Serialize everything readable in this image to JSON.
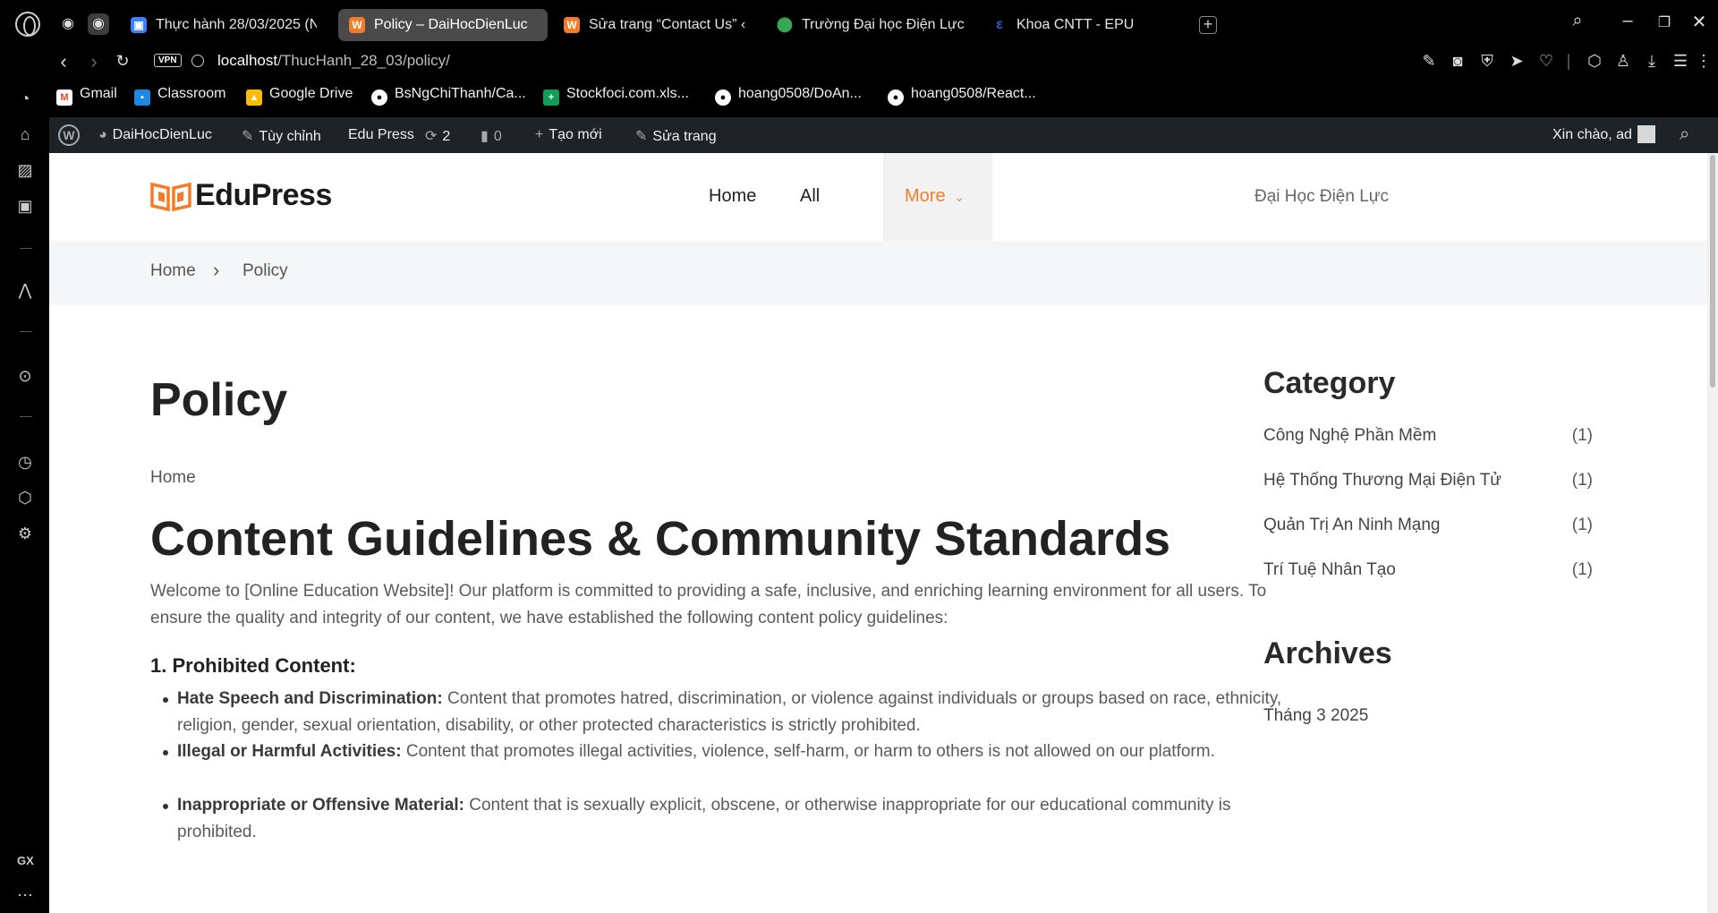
{
  "browser": {
    "tabs": [
      {
        "title": "Thực hành 28/03/2025 (N",
        "icon": "contact-card-icon",
        "color": "#3b82f6"
      },
      {
        "title": "Policy – DaiHocDienLuc",
        "icon": "edupress-favicon",
        "color": "#f57c26",
        "active": true
      },
      {
        "title": "Sửa trang “Contact Us” ‹ D",
        "icon": "edupress-favicon",
        "color": "#f57c26"
      },
      {
        "title": "Trường Đại học Điện Lực -",
        "icon": "map-pin-icon",
        "color": "#34a853"
      },
      {
        "title": "Khoa CNTT - EPU",
        "icon": "epu-logo-icon",
        "color": "#2b5bd7"
      }
    ],
    "url_host": "localhost",
    "url_path": "/ThucHanh_28_03/policy/",
    "vpn_label": "VPN",
    "bookmarks": [
      {
        "label": "Gmail",
        "icon": "gmail-icon"
      },
      {
        "label": "Classroom",
        "icon": "classroom-icon"
      },
      {
        "label": "Google Drive",
        "icon": "drive-icon"
      },
      {
        "label": "BsNgChiThanh/Ca...",
        "icon": "github-icon"
      },
      {
        "label": "Stockfoci.com.xls...",
        "icon": "sheets-icon"
      },
      {
        "label": "hoang0508/DoAn...",
        "icon": "github-icon"
      },
      {
        "label": "hoang0508/React...",
        "icon": "github-icon"
      }
    ],
    "sidebar_gx": "GX"
  },
  "wpbar": {
    "site_name": "DaiHocDienLuc",
    "customize": "Tùy chỉnh",
    "theme": "Edu Press",
    "updates": "2",
    "comments": "0",
    "new": "Tạo mới",
    "edit": "Sửa trang",
    "greeting": "Xin chào, ad"
  },
  "site": {
    "logo_text": "EduPress",
    "nav": {
      "home": "Home",
      "all_post": "All Post",
      "more": "More"
    },
    "header_right": "Đại Học Điện Lực",
    "breadcrumb": {
      "home": "Home",
      "current": "Policy"
    },
    "accent": "#f57c26"
  },
  "main": {
    "page_title": "Policy",
    "home_link": "Home",
    "heading": "Content Guidelines & Community Standards",
    "intro": "Welcome to [Online Education Website]! Our platform is committed to providing a safe, inclusive, and enriching learning environment for all users. To ensure the quality and integrity of our content, we have established the following content policy guidelines:",
    "section1": "1. Prohibited Content:",
    "items": [
      {
        "bold": "Hate Speech and Discrimination:",
        "text": " Content that promotes hatred, discrimination, or violence against individuals or groups based on race, ethnicity, religion, gender, sexual orientation, disability, or other protected characteristics is strictly prohibited."
      },
      {
        "bold": "Illegal or Harmful Activities:",
        "text": " Content that promotes illegal activities, violence, self-harm, or harm to others is not allowed on our platform."
      },
      {
        "bold": "Inappropriate or Offensive Material:",
        "text": " Content that is sexually explicit, obscene, or otherwise inappropriate for our educational community is prohibited."
      }
    ]
  },
  "aside": {
    "category_title": "Category",
    "categories": [
      {
        "name": "Công Nghệ Phần Mềm",
        "count": "(1)"
      },
      {
        "name": "Hệ Thống Thương Mại Điện Tử",
        "count": "(1)"
      },
      {
        "name": "Quản Trị An Ninh Mạng",
        "count": "(1)"
      },
      {
        "name": "Trí Tuệ Nhân Tạo",
        "count": "(1)"
      }
    ],
    "archives_title": "Archives",
    "archives": [
      "Tháng 3 2025"
    ]
  }
}
